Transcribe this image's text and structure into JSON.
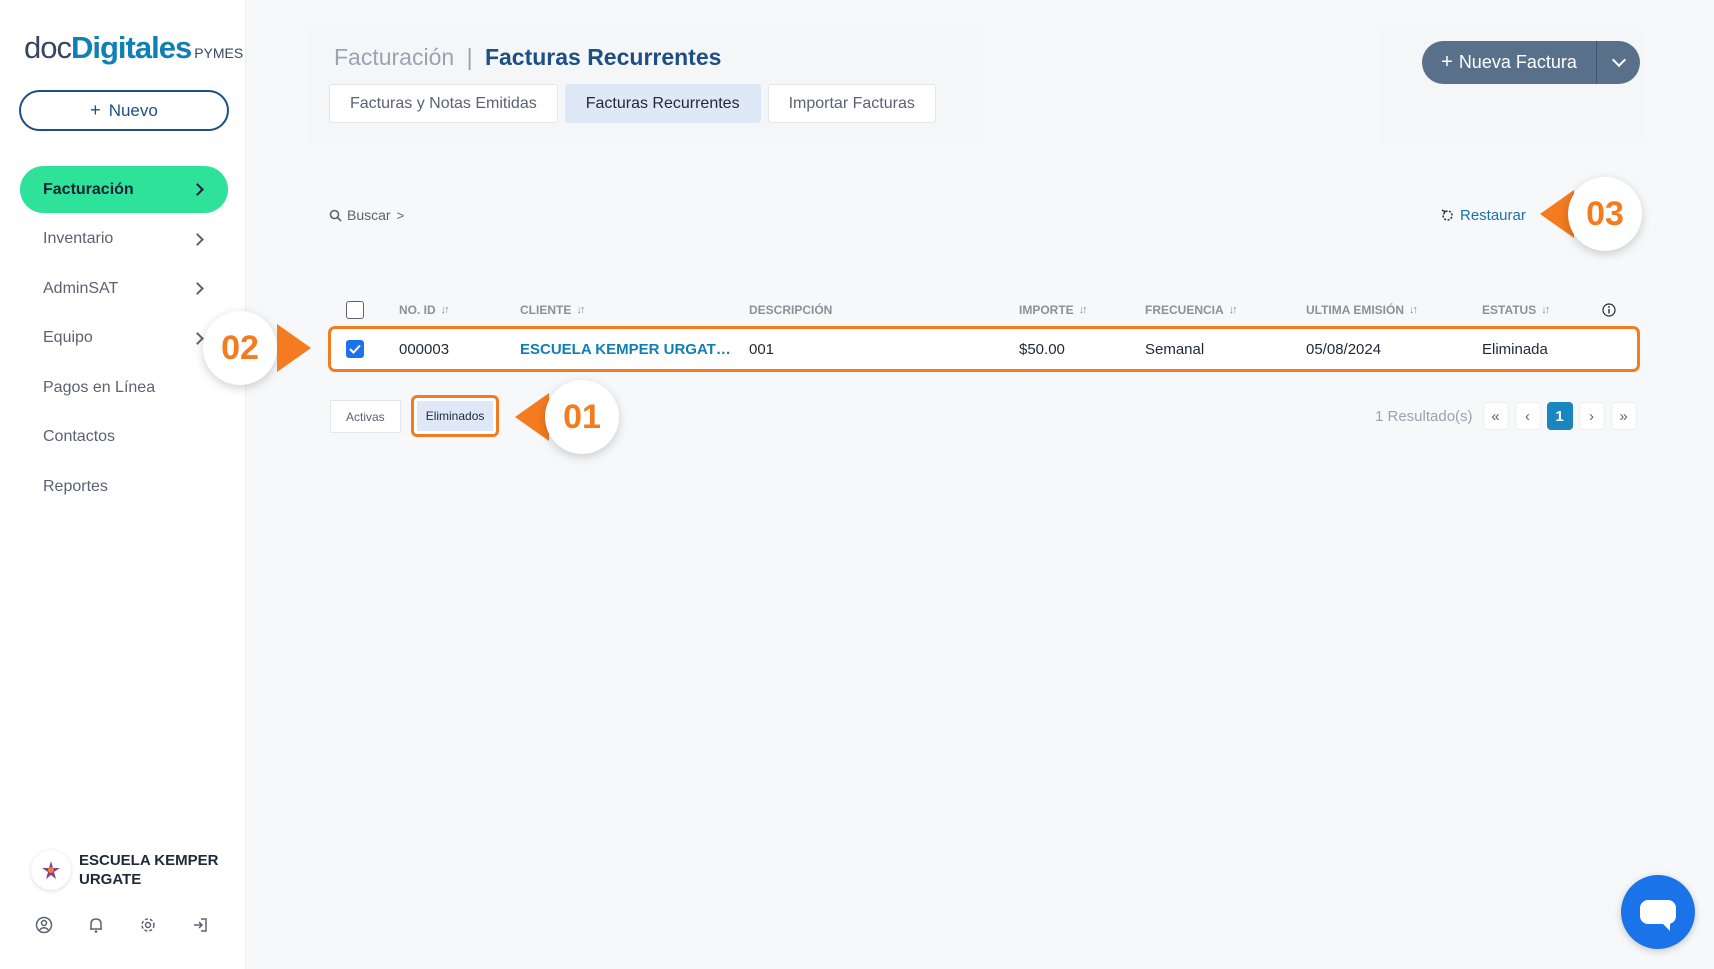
{
  "sidebar": {
    "logo": {
      "part1": "doc",
      "part2": "Digitales",
      "part3": "PYMES"
    },
    "new_button": {
      "icon": "plus-icon",
      "label": "Nuevo"
    },
    "items": [
      {
        "label": "Facturación",
        "active": true,
        "chevron": true
      },
      {
        "label": "Inventario",
        "chevron": true
      },
      {
        "label": "AdminSAT",
        "chevron": true
      },
      {
        "label": "Equipo",
        "chevron": true
      },
      {
        "label": "Pagos en Línea",
        "chevron": false
      },
      {
        "label": "Contactos",
        "chevron": false
      },
      {
        "label": "Reportes",
        "chevron": false
      }
    ],
    "account_name": "ESCUELA KEMPER URGATE",
    "bottom_icons": [
      "user-icon",
      "bell-icon",
      "gear-icon",
      "logout-icon"
    ]
  },
  "header": {
    "title_section": "Facturación",
    "title_separator": "|",
    "title_page": "Facturas Recurrentes",
    "tabs": [
      {
        "label": "Facturas y Notas Emitidas",
        "active": false
      },
      {
        "label": "Facturas Recurrentes",
        "active": true
      },
      {
        "label": "Importar Facturas",
        "active": false
      }
    ],
    "nueva_button": {
      "icon": "plus-icon",
      "label": "Nueva Factura",
      "caret_icon": "chevron-down-icon"
    }
  },
  "toolbar": {
    "search_label": "Buscar",
    "search_chevron": ">",
    "restore_label": "Restaurar"
  },
  "table": {
    "columns": [
      "NO. ID",
      "CLIENTE",
      "DESCRIPCIÓN",
      "IMPORTE",
      "FRECUENCIA",
      "ULTIMA EMISIÓN",
      "ESTATUS"
    ],
    "rows": [
      {
        "checked": true,
        "id": "000003",
        "cliente": "ESCUELA KEMPER URGAT…",
        "descripcion": "001",
        "importe": "$50.00",
        "frecuencia": "Semanal",
        "ultima_emision": "05/08/2024",
        "estatus": "Eliminada"
      }
    ]
  },
  "filters": {
    "active_label": "Activas",
    "deleted_label": "Eliminados"
  },
  "pagination": {
    "results": "1 Resultado(s)",
    "current_page": "1"
  },
  "callouts": {
    "c01": "01",
    "c02": "02",
    "c03": "03"
  },
  "colors": {
    "accent": "#f47b20",
    "brand": "#1c4f86",
    "active_nav": "#2ee29a",
    "chat": "#1a73e8"
  }
}
